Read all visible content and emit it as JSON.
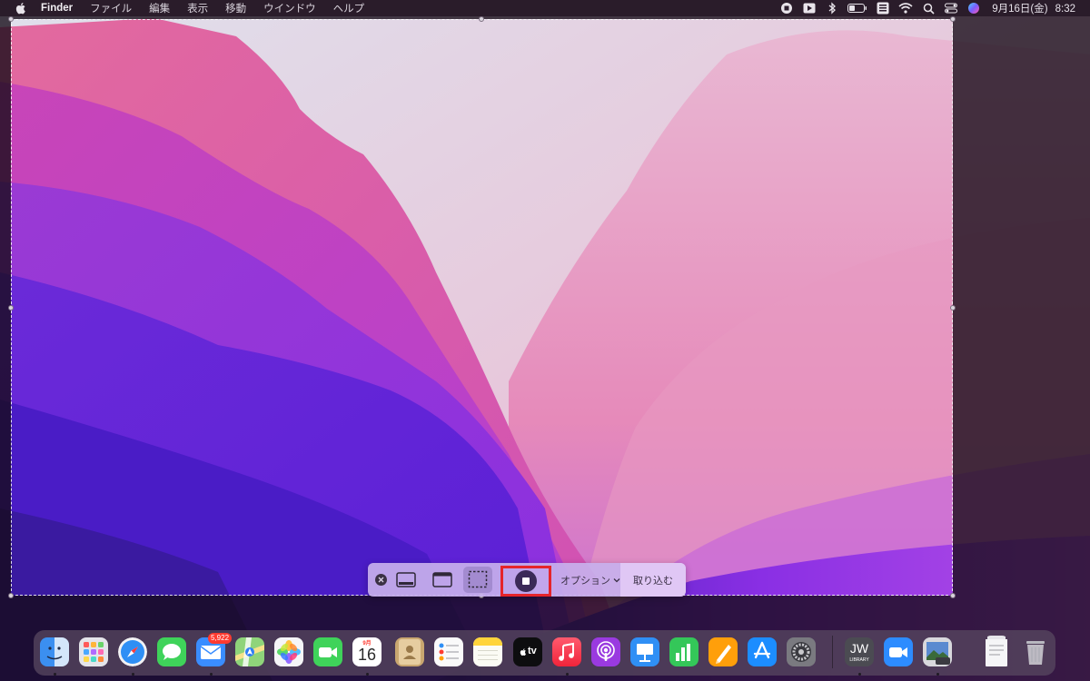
{
  "menubar": {
    "app_name": "Finder",
    "items": [
      "ファイル",
      "編集",
      "表示",
      "移動",
      "ウインドウ",
      "ヘルプ"
    ],
    "status_icons": [
      "screen-record-stop-icon",
      "video-icon",
      "bluetooth-icon",
      "battery-icon",
      "input-method-icon",
      "wifi-icon",
      "spotlight-search-icon",
      "control-center-icon",
      "siri-icon"
    ],
    "date": "9月16日(金)",
    "time": "8:32"
  },
  "toolbar": {
    "options_label": "オプション",
    "capture_label": "取り込む"
  },
  "dock": {
    "mail_badge": "5,922",
    "calendar_month": "9月",
    "calendar_day": "16",
    "appletv_label": "tv",
    "jw_label": "JW",
    "jw_sub": "LIBRARY",
    "items": [
      "Finder",
      "Launchpad",
      "Safari",
      "メッセージ",
      "メール",
      "マップ",
      "写真",
      "FaceTime",
      "カレンダー",
      "連絡先",
      "リマインダー",
      "メモ",
      "Apple TV",
      "ミュージック",
      "Podcast",
      "Keynote",
      "Numbers",
      "Pages",
      "App Store",
      "システム環境設定",
      "JW Library",
      "Zoom",
      "プレビュー",
      "ダウンロード",
      "ゴミ箱"
    ]
  }
}
